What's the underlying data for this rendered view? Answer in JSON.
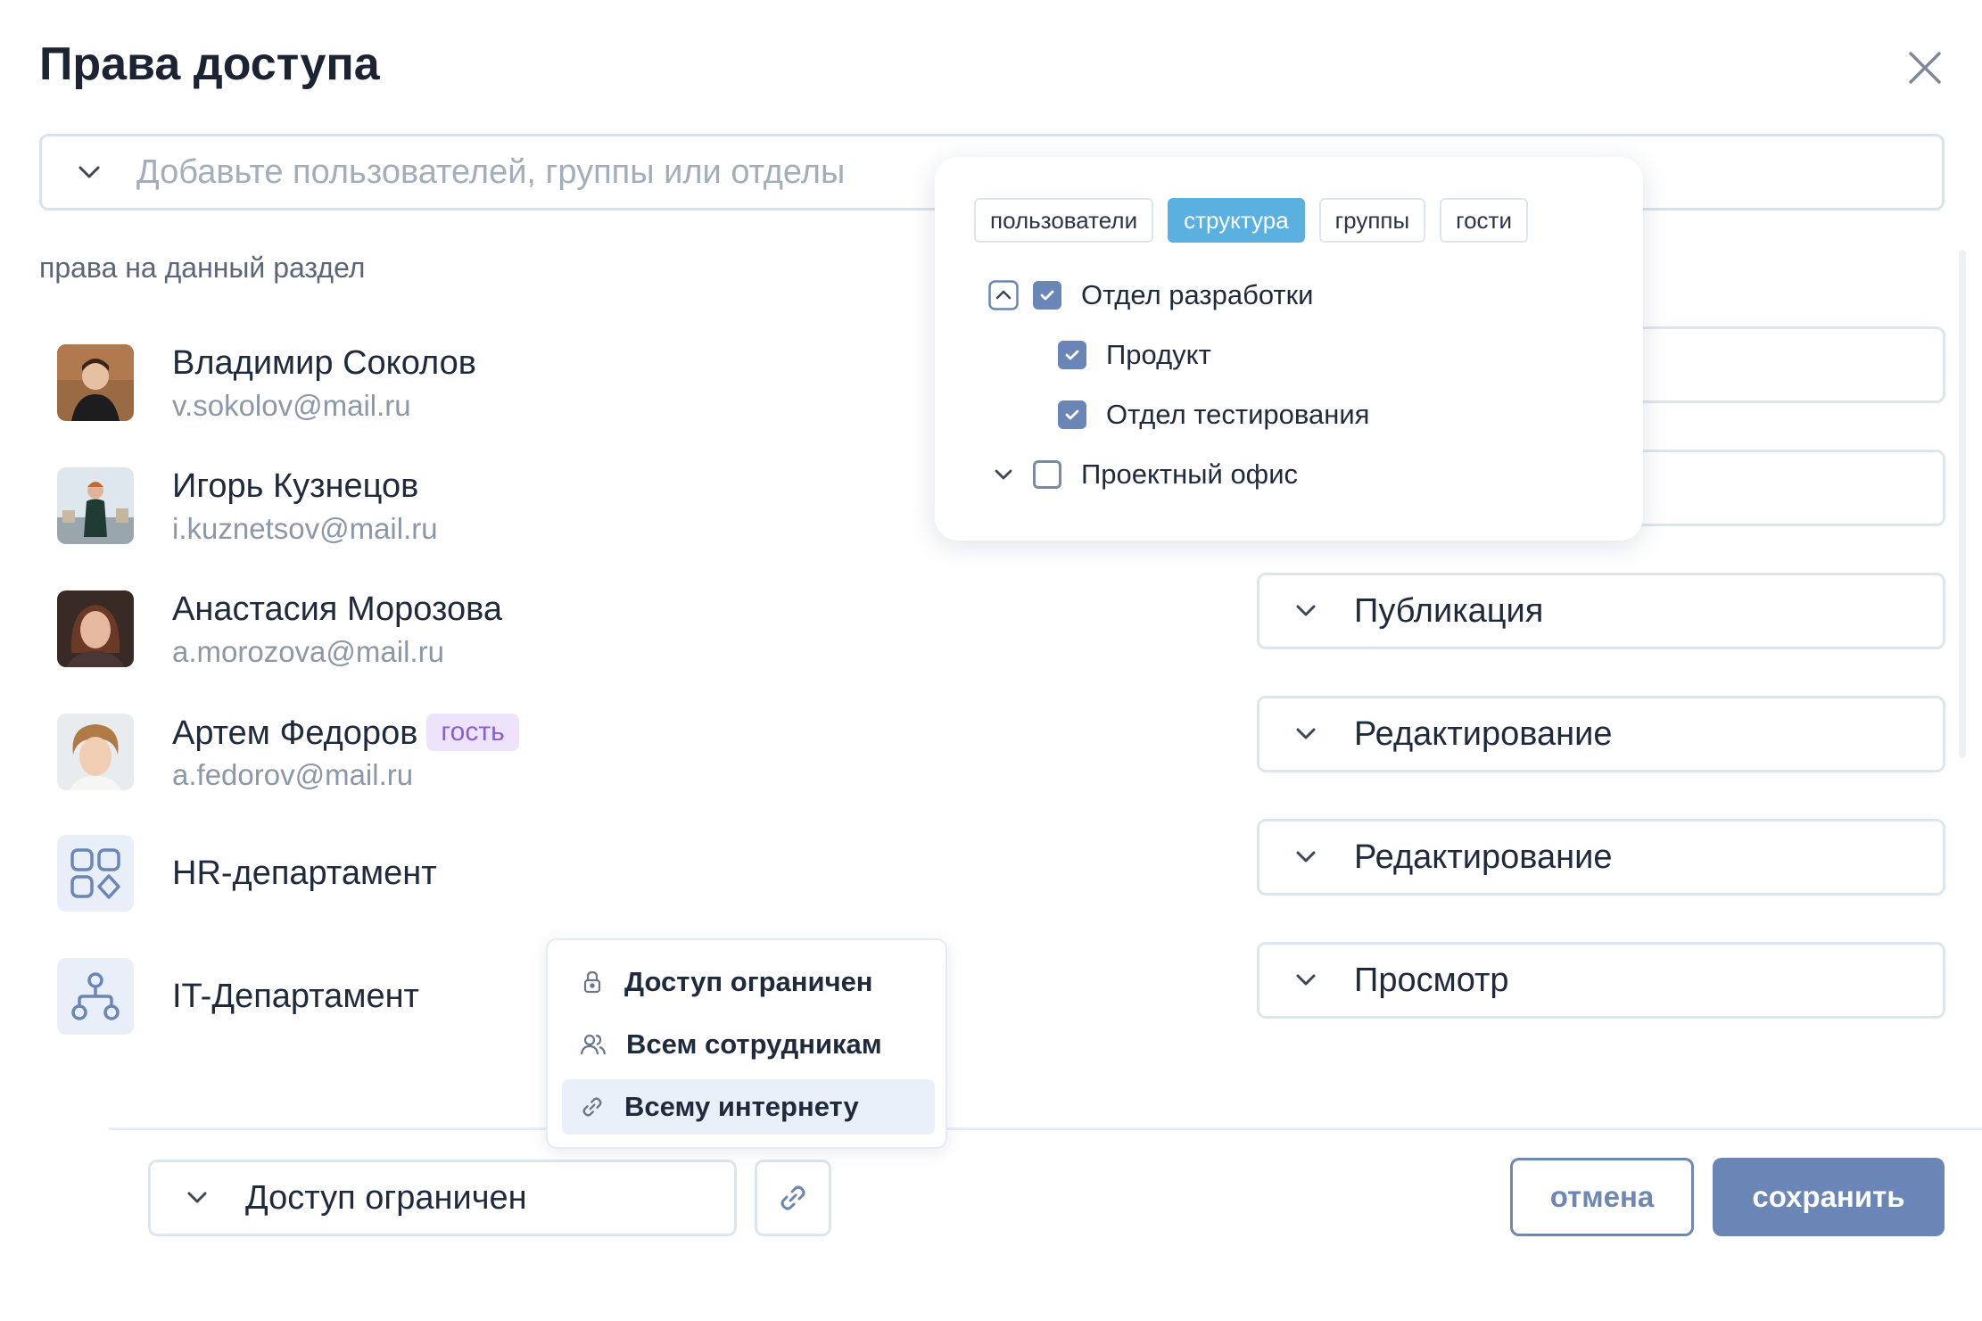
{
  "dialog": {
    "title": "Права доступа"
  },
  "search": {
    "placeholder": "Добавьте пользователей, группы или отделы"
  },
  "section_label": "права на данный раздел",
  "members": [
    {
      "name": "Владимир Соколов",
      "email": "v.sokolov@mail.ru"
    },
    {
      "name": "Игорь Кузнецов",
      "email": "i.kuznetsov@mail.ru"
    },
    {
      "name": "Анастасия Морозова",
      "email": "a.morozova@mail.ru",
      "permission": "Публикация"
    },
    {
      "name": "Артем Федоров",
      "email": "a.fedorov@mail.ru",
      "badge": "гость",
      "permission": "Редактирование"
    },
    {
      "name": "HR-департамент",
      "permission": "Редактирование",
      "icon": "grid-shapes-icon"
    },
    {
      "name": "IT-Департамент",
      "permission": "Просмотр",
      "icon": "org-structure-icon"
    }
  ],
  "popup": {
    "tabs": [
      "пользователи",
      "структура",
      "группы",
      "гости"
    ],
    "active_tab": "структура",
    "tree": [
      {
        "label": "Отдел разработки",
        "checked": true,
        "expanded": true
      },
      {
        "label": "Продукт",
        "checked": true
      },
      {
        "label": "Отдел тестирования",
        "checked": true
      },
      {
        "label": "Проектный офис",
        "checked": false,
        "expanded": false
      }
    ]
  },
  "access_menu": {
    "items": [
      {
        "label": "Доступ ограничен",
        "icon": "lock-icon"
      },
      {
        "label": "Всем сотрудникам",
        "icon": "users-icon"
      },
      {
        "label": "Всему интернету",
        "icon": "link-icon",
        "highlighted": true
      }
    ]
  },
  "footer": {
    "access_value": "Доступ ограничен",
    "cancel_label": "отмена",
    "save_label": "сохранить"
  },
  "colors": {
    "accent": "#6a86b6",
    "tab_active": "#5ab0de",
    "guest_badge_bg": "#ede3fb",
    "guest_badge_text": "#8a5ed6"
  }
}
